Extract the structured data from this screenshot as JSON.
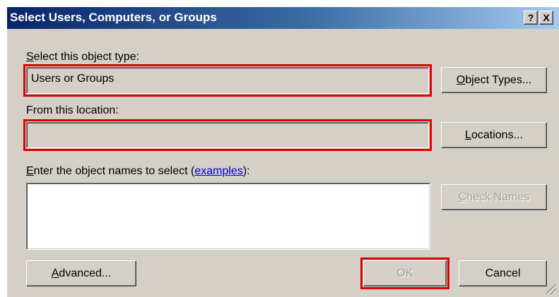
{
  "window": {
    "title": "Select Users, Computers, or Groups",
    "help_glyph": "?",
    "close_glyph": "X"
  },
  "object_type": {
    "label_accel": "S",
    "label_rest": "elect this object type:",
    "value": "Users or Groups",
    "button_accel": "O",
    "button_rest": "bject Types..."
  },
  "location": {
    "label": "From this location:",
    "value": "",
    "button_accel": "L",
    "button_rest": "ocations..."
  },
  "names": {
    "label_accel": "E",
    "label_rest": "nter the object names to select (",
    "label_link": "examples",
    "label_end": "):",
    "value": "",
    "check_accel": "C",
    "check_rest": "heck Names"
  },
  "footer": {
    "advanced_accel": "A",
    "advanced_rest": "dvanced...",
    "ok_label": "OK",
    "cancel_label": "Cancel"
  },
  "colors": {
    "highlight": "#e00000",
    "dialog_face": "#d4d0c8",
    "title_start": "#0a246a",
    "title_end": "#a6caf0"
  },
  "icons": [
    "help-icon",
    "close-icon",
    "resize-grip-icon"
  ]
}
